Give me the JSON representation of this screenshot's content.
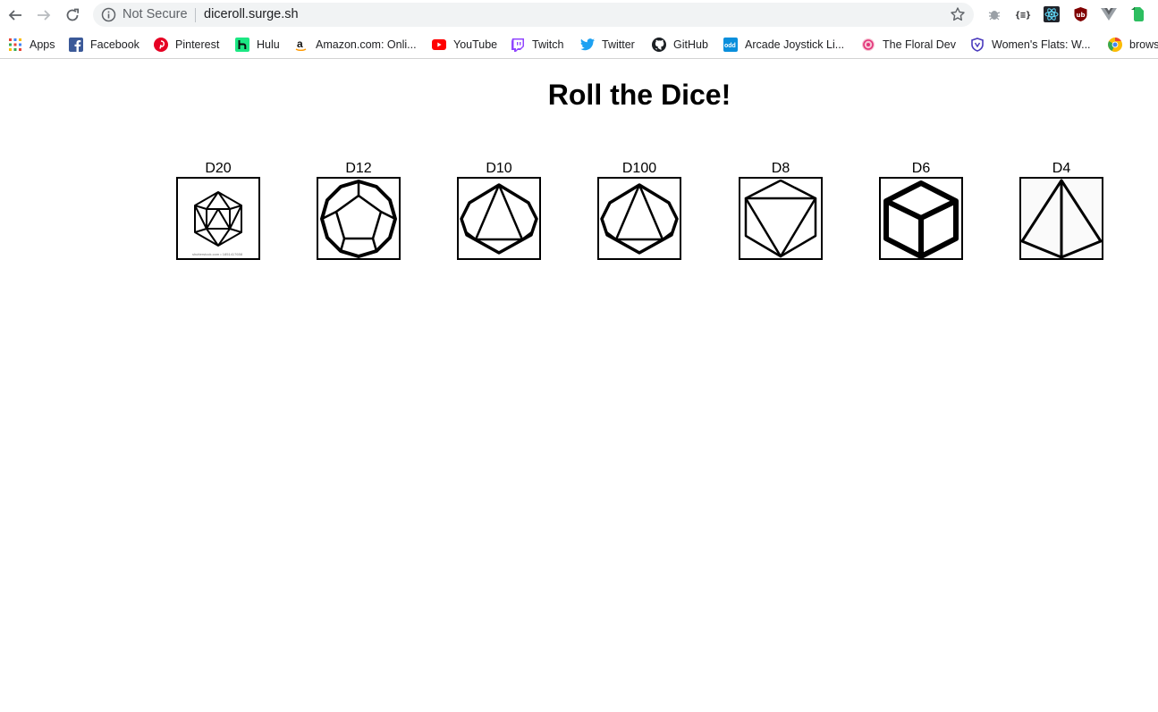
{
  "browser": {
    "security_text": "Not Secure",
    "url": "diceroll.surge.sh"
  },
  "bookmarks": [
    {
      "label": "Apps",
      "icon": "apps-grid-icon"
    },
    {
      "label": "Facebook",
      "icon": "facebook-icon"
    },
    {
      "label": "Pinterest",
      "icon": "pinterest-icon"
    },
    {
      "label": "Hulu",
      "icon": "hulu-icon"
    },
    {
      "label": "Amazon.com: Onli...",
      "icon": "amazon-icon"
    },
    {
      "label": "YouTube",
      "icon": "youtube-icon"
    },
    {
      "label": "Twitch",
      "icon": "twitch-icon"
    },
    {
      "label": "Twitter",
      "icon": "twitter-icon"
    },
    {
      "label": "GitHub",
      "icon": "github-icon"
    },
    {
      "label": "Arcade Joystick Li...",
      "icon": "arcade-icon"
    },
    {
      "label": "The Floral Dev",
      "icon": "floral-icon"
    },
    {
      "label": "Women's Flats: W...",
      "icon": "shield-icon"
    },
    {
      "label": "brows",
      "icon": "chrome-icon"
    }
  ],
  "page": {
    "title": "Roll the Dice!"
  },
  "dice": [
    {
      "label": "D20",
      "icon": "d20-icon",
      "credit": "shutterstock.com • 1851417658"
    },
    {
      "label": "D12",
      "icon": "d12-icon"
    },
    {
      "label": "D10",
      "icon": "d10-icon"
    },
    {
      "label": "D100",
      "icon": "d100-icon"
    },
    {
      "label": "D8",
      "icon": "d8-icon"
    },
    {
      "label": "D6",
      "icon": "d6-icon"
    },
    {
      "label": "D4",
      "icon": "d4-icon"
    }
  ],
  "colors": {
    "omnibox_bg": "#f1f3f4",
    "text": "#202124",
    "muted": "#5f6368",
    "dice_stroke": "#000000"
  }
}
